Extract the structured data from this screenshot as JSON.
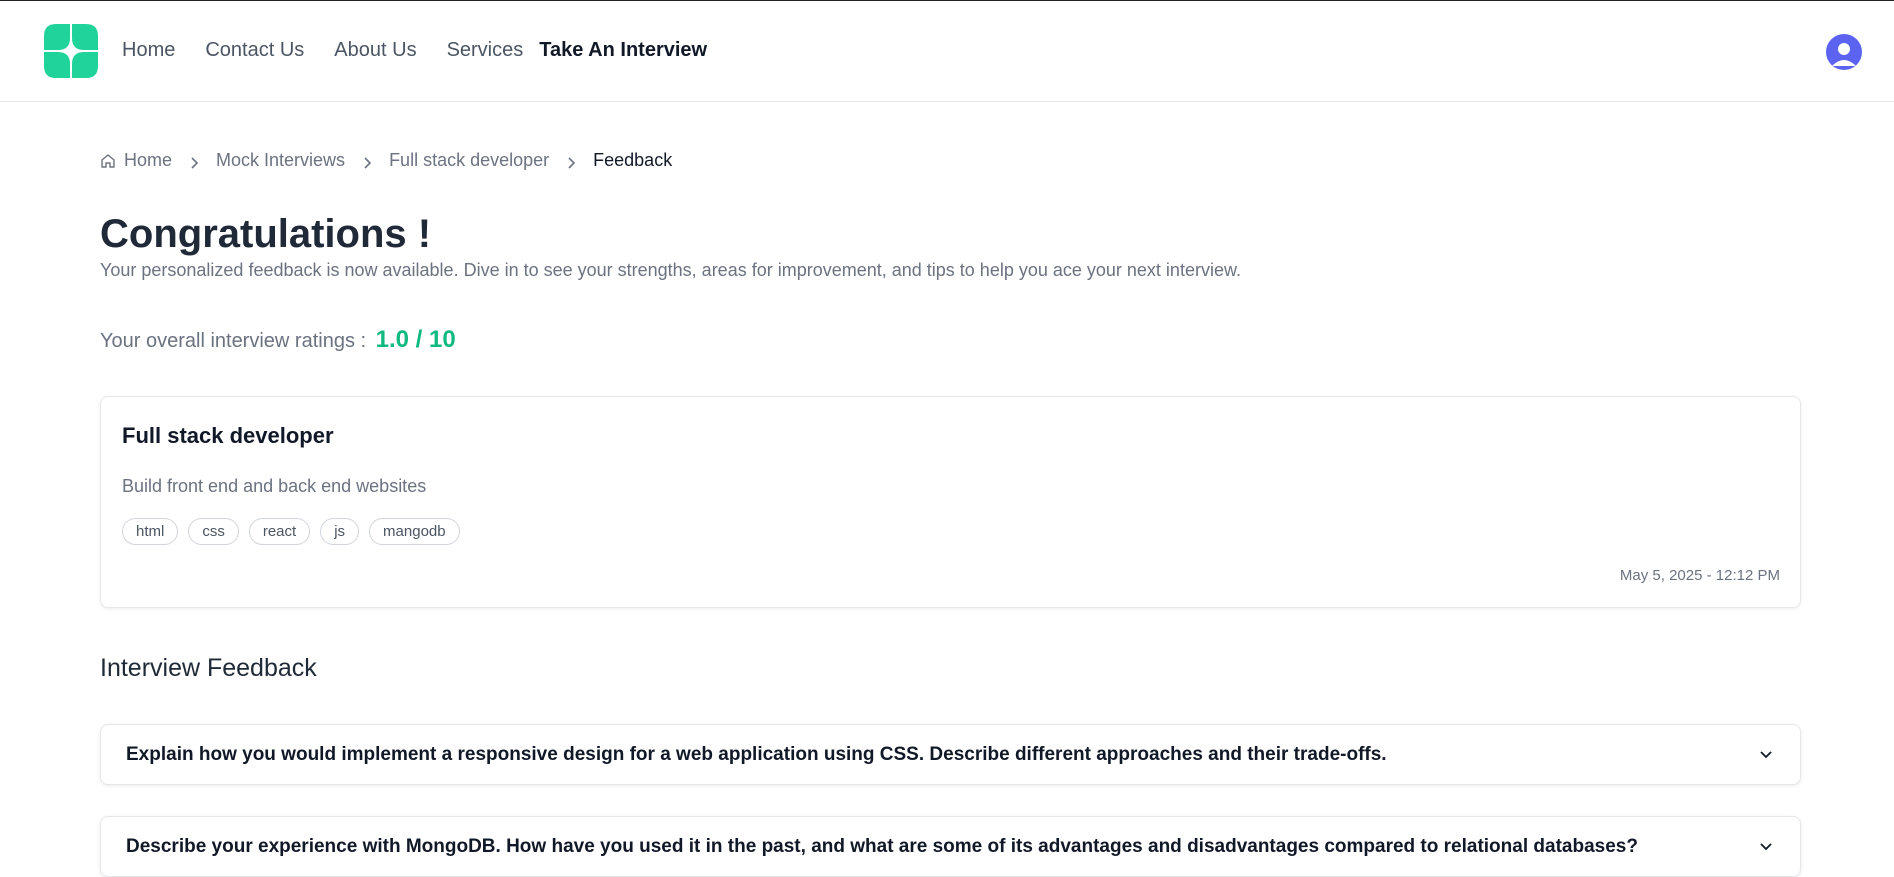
{
  "nav": {
    "items": [
      {
        "label": "Home"
      },
      {
        "label": "Contact Us"
      },
      {
        "label": "About Us"
      },
      {
        "label": "Services"
      },
      {
        "label": "Take An Interview"
      }
    ]
  },
  "colors": {
    "brand": "#1fd39a",
    "accent": "#10b981",
    "avatar": "#5b63f0"
  },
  "icons": [
    "logo-icon",
    "user-avatar-icon",
    "home-icon",
    "chevron-right-icon",
    "chevron-down-icon"
  ],
  "breadcrumb": {
    "items": [
      {
        "label": "Home"
      },
      {
        "label": "Mock Interviews"
      },
      {
        "label": "Full stack developer"
      },
      {
        "label": "Feedback"
      }
    ]
  },
  "page": {
    "title": "Congratulations !",
    "subtitle": "Your personalized feedback is now available. Dive in to see your strengths, areas for improvement, and tips to help you ace your next interview.",
    "rating_label": "Your overall interview ratings :",
    "rating_value": "1.0 / 10"
  },
  "interview": {
    "title": "Full stack developer",
    "description": "Build front end and back end websites",
    "tags": [
      "html",
      "css",
      "react",
      "js",
      "mangodb"
    ],
    "date": "May 5, 2025 - 12:12 PM"
  },
  "feedback": {
    "heading": "Interview Feedback",
    "questions": [
      {
        "text": "Explain how you would implement a responsive design for a web application using CSS. Describe different approaches and their trade-offs."
      },
      {
        "text": "Describe your experience with MongoDB. How have you used it in the past, and what are some of its advantages and disadvantages compared to relational databases?"
      }
    ]
  }
}
